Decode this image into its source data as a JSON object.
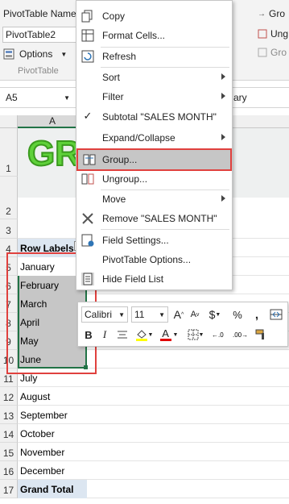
{
  "ribbon": {
    "pivot_name_label": "PivotTable Name:",
    "pivot_name_value": "PivotTable2",
    "options_label": "Options",
    "group_label": "PivotTable",
    "right_group_label": "Gro",
    "right_ungroup_label": "Ung",
    "right_groupfield_label": "Gro"
  },
  "formula_bar": {
    "name_box": "A5",
    "formula_text": "ary"
  },
  "grid": {
    "col_header": "A",
    "rows": [
      {
        "num": "1",
        "text": ""
      },
      {
        "num": "2",
        "text": ""
      },
      {
        "num": "3",
        "text": ""
      },
      {
        "num": "4",
        "text": "Row Labels"
      },
      {
        "num": "5",
        "text": "January"
      },
      {
        "num": "6",
        "text": "February"
      },
      {
        "num": "7",
        "text": "March"
      },
      {
        "num": "8",
        "text": "April"
      },
      {
        "num": "9",
        "text": "May"
      },
      {
        "num": "10",
        "text": "June"
      },
      {
        "num": "11",
        "text": "July"
      },
      {
        "num": "12",
        "text": "August"
      },
      {
        "num": "13",
        "text": "September"
      },
      {
        "num": "14",
        "text": "October"
      },
      {
        "num": "15",
        "text": "November"
      },
      {
        "num": "16",
        "text": "December"
      },
      {
        "num": "17",
        "text": "Grand Total"
      }
    ],
    "banner_text": "GR"
  },
  "context_menu": {
    "items": [
      {
        "label": "Copy",
        "icon": "copy-icon"
      },
      {
        "label": "Format Cells...",
        "icon": "format-cells-icon"
      },
      {
        "label": "Refresh",
        "icon": "refresh-icon"
      },
      {
        "label": "Sort",
        "icon": ""
      },
      {
        "label": "Filter",
        "icon": ""
      },
      {
        "label": "Subtotal \"SALES MONTH\"",
        "icon": "checkmark-icon"
      },
      {
        "label": "Expand/Collapse",
        "icon": ""
      },
      {
        "label": "Group...",
        "icon": "group-icon"
      },
      {
        "label": "Ungroup...",
        "icon": "ungroup-icon"
      },
      {
        "label": "Move",
        "icon": ""
      },
      {
        "label": "Remove \"SALES MONTH\"",
        "icon": "remove-icon"
      },
      {
        "label": "Field Settings...",
        "icon": "field-settings-icon"
      },
      {
        "label": "PivotTable Options...",
        "icon": ""
      },
      {
        "label": "Hide Field List",
        "icon": "field-list-icon"
      }
    ]
  },
  "mini_toolbar": {
    "font_name": "Calibri",
    "font_size": "11",
    "grow_font": "A",
    "shrink_font": "A",
    "currency": "$",
    "percent": "%",
    "comma": ",",
    "bold": "B",
    "italic": "I",
    "font_color_letter": "A"
  },
  "colors": {
    "selection_fill": "#c6c6c6",
    "highlight_border": "#e0413e",
    "header_fill": "#dce6f1",
    "banner_green": "#5fd13a"
  }
}
